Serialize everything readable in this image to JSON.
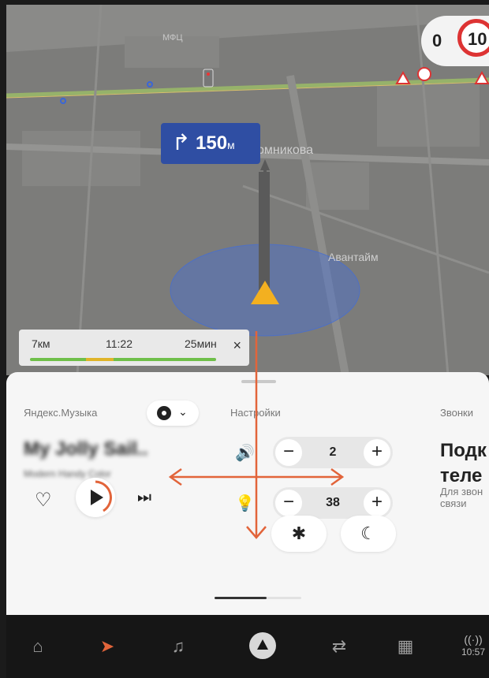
{
  "map": {
    "poi_top": "МФЦ",
    "street": "омникова",
    "poi_right": "Авантайм",
    "speed_current": "0",
    "speed_limit": "10",
    "maneuver": {
      "distance": "150",
      "unit": "м"
    }
  },
  "route_summary": {
    "distance": "7км",
    "arrival": "11:22",
    "duration": "25мин",
    "close": "×"
  },
  "music": {
    "section": "Яндекс.Музыка",
    "track_title": "My Jolly Sail..",
    "track_artist": "Modern Handy Color"
  },
  "settings": {
    "section": "Настройки",
    "volume_value": "2",
    "brightness_value": "38",
    "minus_glyph": "−",
    "plus_glyph": "+"
  },
  "calls": {
    "section": "Звонки",
    "title_line1": "Подк",
    "title_line2": "теле",
    "desc_line1": "Для звон",
    "desc_line2": "связи"
  },
  "status_bar": {
    "time": "10:57"
  },
  "colors": {
    "accent": "#e2643a",
    "route_blue": "#2f4ea3"
  }
}
